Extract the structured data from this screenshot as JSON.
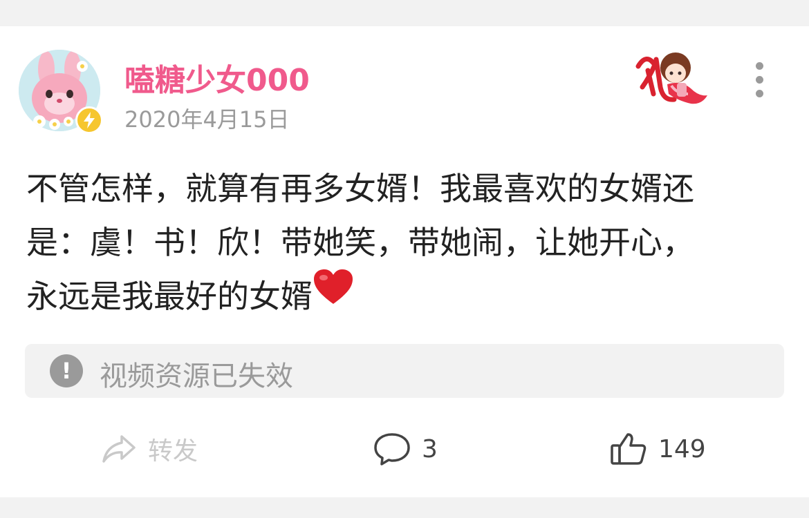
{
  "post": {
    "username": "嗑糖少女000",
    "date": "2020年4月15日",
    "text_lines": [
      "不管怎样，就算有再多女婿！我最喜欢的女婿还",
      "是：虞！书！欣！带她笑，带她闹，让她开心，",
      "永远是我最好的女婿"
    ],
    "emoji": "heart-emoji"
  },
  "notice": {
    "text": "视频资源已失效",
    "icon": "exclamation-icon"
  },
  "actions": {
    "share_label": "转发",
    "comment_count": "3",
    "like_count": "149"
  },
  "colors": {
    "username": "#f05a8c",
    "badge": "#f6c62e",
    "muted": "#9a9a9a",
    "share_disabled": "#c9c9c9",
    "heart": "#e0202a"
  }
}
